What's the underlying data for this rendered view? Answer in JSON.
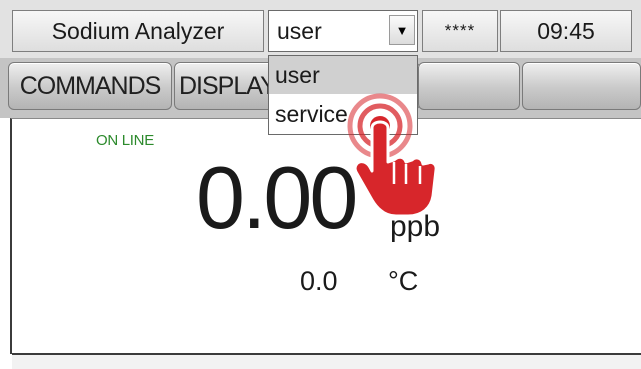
{
  "header": {
    "title": "Sodium Analyzer",
    "user_select_value": "user",
    "dropdown_arrow": "▼",
    "password_mask": "****",
    "time": "09:45"
  },
  "tabs": [
    {
      "label": "COMMANDS"
    },
    {
      "label": "DISPLAY"
    },
    {
      "label": ""
    },
    {
      "label": ""
    }
  ],
  "dropdown": {
    "options": [
      "user",
      "service"
    ],
    "highlighted": "user"
  },
  "display": {
    "status": "ON LINE",
    "status_color": "#2c8a2c",
    "value": "0.00",
    "unit": "ppb",
    "temperature": "0.0",
    "temperature_unit": "°C"
  },
  "overlay": {
    "icon": "hand-pointer-icon",
    "color": "#d7262b"
  }
}
